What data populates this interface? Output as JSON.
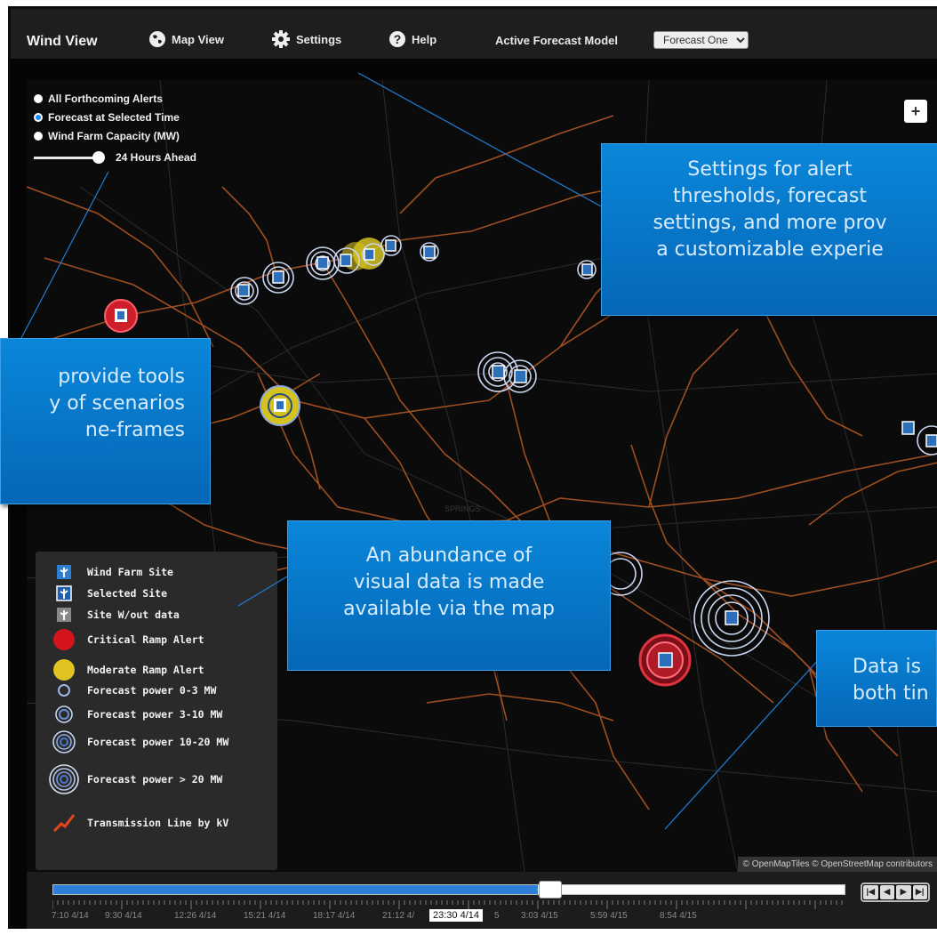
{
  "nav": {
    "brand": "Wind View",
    "map_view": "Map View",
    "settings": "Settings",
    "help": "Help",
    "model_label": "Active Forecast Model",
    "model_selected": "Forecast One"
  },
  "options": {
    "items": [
      "All Forthcoming Alerts",
      "Forecast at Selected Time",
      "Wind Farm Capacity (MW)"
    ],
    "selected_index": 1,
    "slider_label": "24 Hours Ahead"
  },
  "zoom_label": "+",
  "legend": [
    {
      "icon": "wind-farm-site-icon",
      "label": "Wind Farm Site"
    },
    {
      "icon": "selected-site-icon",
      "label": "Selected Site"
    },
    {
      "icon": "site-without-data-icon",
      "label": "Site W/out data"
    },
    {
      "icon": "critical-ramp-alert-icon",
      "label": "Critical Ramp Alert"
    },
    {
      "icon": "moderate-ramp-alert-icon",
      "label": "Moderate Ramp Alert"
    },
    {
      "icon": "forecast-power-1-ring-icon",
      "label": "Forecast power 0-3 MW"
    },
    {
      "icon": "forecast-power-2-ring-icon",
      "label": "Forecast power 3-10 MW"
    },
    {
      "icon": "forecast-power-3-ring-icon",
      "label": "Forecast power 10-20 MW"
    },
    {
      "icon": "forecast-power-4-ring-icon",
      "label": "Forecast power > 20 MW"
    },
    {
      "icon": "transmission-line-icon",
      "label": "Transmission Line by kV"
    }
  ],
  "attribution": "© OpenMapTiles © OpenStreetMap contributors",
  "callouts": {
    "settings": [
      "Settings for alert",
      "thresholds, forecast",
      "settings, and more prov",
      "a customizable experie"
    ],
    "tools": [
      "provide tools",
      "y of scenarios",
      "ne-frames"
    ],
    "map": [
      "An abundance of",
      "visual data is made",
      "available via the map"
    ],
    "time": [
      "Data is",
      "both tin"
    ]
  },
  "timeline": {
    "progress": 0.612,
    "labels": [
      "7:10 4/14",
      "9:30 4/14",
      "12:26 4/14",
      "15:21 4/14",
      "18:17 4/14",
      "21:12 4/",
      "23:30 4/14",
      "5",
      "3:03 4/15",
      "5:59 4/15",
      "8:54 4/15"
    ],
    "current_index": 6,
    "transport": [
      "|◀",
      "◀",
      "▶",
      "▶|"
    ]
  },
  "colors": {
    "callout_blue": "#0a77c9",
    "nav_bg": "#1e1e1e",
    "map_bg": "#0b0b0b",
    "transmission_orange": "#c8642a",
    "critical_red": "#cc1f2a",
    "moderate_yellow": "#d4c21f",
    "timeline_blue": "#2f7ed8"
  }
}
